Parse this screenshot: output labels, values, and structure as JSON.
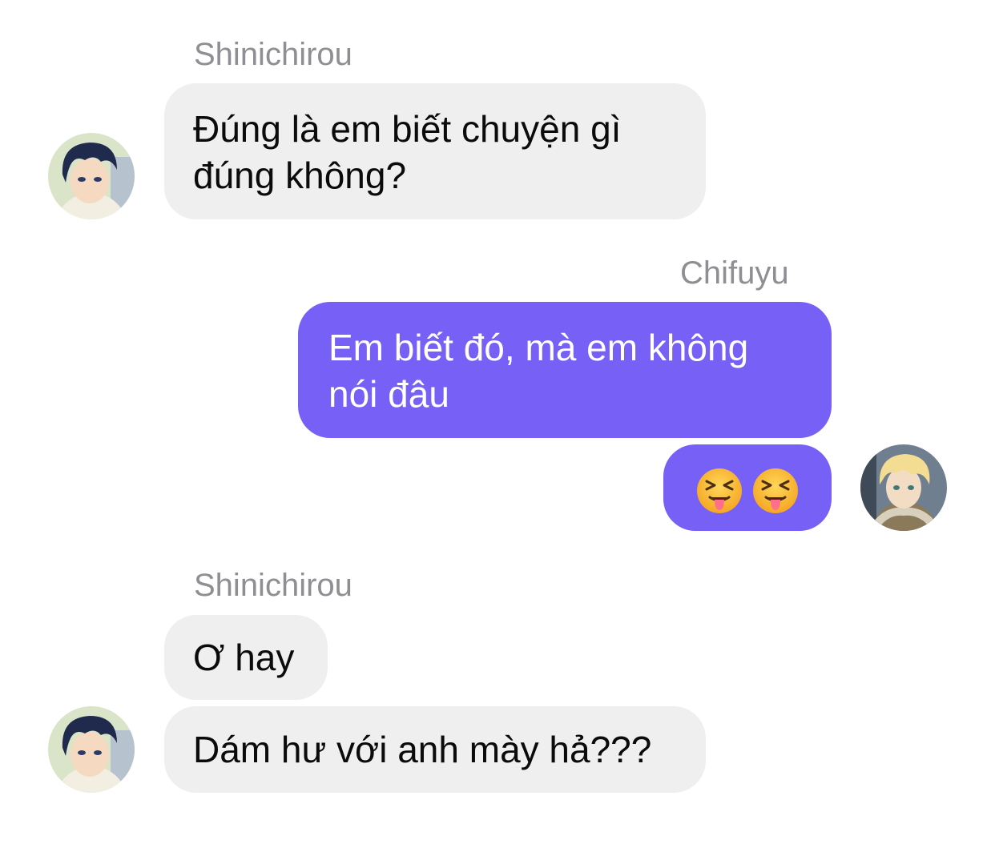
{
  "messages": [
    {
      "sender": "Shinichirou",
      "lines": [
        "Đúng là em biết chuyện gì",
        "đúng không?"
      ]
    },
    {
      "sender": "Chifuyu",
      "lines": [
        "Em biết đó, mà em không",
        "nói đâu"
      ]
    },
    {
      "emojis": [
        "squinting-face-with-tongue",
        "squinting-face-with-tongue"
      ]
    },
    {
      "sender": "Shinichirou",
      "text": "Ơ hay"
    },
    {
      "text": "Dám hư với anh mày hả???"
    }
  ],
  "colors": {
    "incoming_bubble": "#efefef",
    "outgoing_bubble": "#7760f5",
    "sender_name": "#8e8e93"
  }
}
